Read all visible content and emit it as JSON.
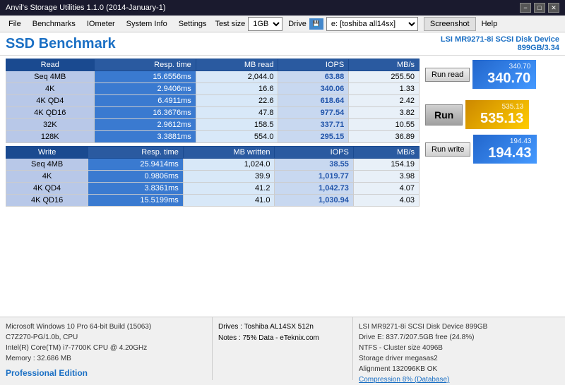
{
  "titleBar": {
    "title": "Anvil's Storage Utilities 1.1.0 (2014-January-1)",
    "minBtn": "−",
    "maxBtn": "□",
    "closeBtn": "✕"
  },
  "menuBar": {
    "file": "File",
    "benchmarks": "Benchmarks",
    "iometer": "IOmeter",
    "systemInfo": "System Info",
    "settings": "Settings",
    "testSizeLabel": "Test size",
    "testSizeValue": "1GB",
    "driveLabel": "Drive",
    "driveValue": "e: [toshiba all14sx]",
    "screenshot": "Screenshot",
    "help": "Help"
  },
  "header": {
    "title": "SSD Benchmark",
    "deviceLine1": "LSI MR9271-8i SCSI Disk Device",
    "deviceLine2": "899GB/3.34"
  },
  "readTable": {
    "headers": [
      "Read",
      "Resp. time",
      "MB read",
      "IOPS",
      "MB/s"
    ],
    "rows": [
      [
        "Seq 4MB",
        "15.6556ms",
        "2,044.0",
        "63.88",
        "255.50"
      ],
      [
        "4K",
        "2.9406ms",
        "16.6",
        "340.06",
        "1.33"
      ],
      [
        "4K QD4",
        "6.4911ms",
        "22.6",
        "618.64",
        "2.42"
      ],
      [
        "4K QD16",
        "16.3676ms",
        "47.8",
        "977.54",
        "3.82"
      ],
      [
        "32K",
        "2.9612ms",
        "158.5",
        "337.71",
        "10.55"
      ],
      [
        "128K",
        "3.3881ms",
        "554.0",
        "295.15",
        "36.89"
      ]
    ]
  },
  "writeTable": {
    "headers": [
      "Write",
      "Resp. time",
      "MB written",
      "IOPS",
      "MB/s"
    ],
    "rows": [
      [
        "Seq 4MB",
        "25.9414ms",
        "1,024.0",
        "38.55",
        "154.19"
      ],
      [
        "4K",
        "0.9806ms",
        "39.9",
        "1,019.77",
        "3.98"
      ],
      [
        "4K QD4",
        "3.8361ms",
        "41.2",
        "1,042.73",
        "4.07"
      ],
      [
        "4K QD16",
        "15.5199ms",
        "41.0",
        "1,030.94",
        "4.03"
      ]
    ]
  },
  "scores": {
    "readLabel": "340.70",
    "readSmall": "340.70",
    "totalLabel": "535.13",
    "totalSmall": "535.13",
    "writeLabel": "194.43",
    "writeSmall": "194.43"
  },
  "buttons": {
    "runRead": "Run read",
    "run": "Run",
    "runWrite": "Run write"
  },
  "footer": {
    "leftLines": [
      "Microsoft Windows 10 Pro 64-bit Build (15063)",
      "C7Z270-PG/1.0b, CPU",
      "Intel(R) Core(TM) i7-7700K CPU @ 4.20GHz",
      "Memory : 32.686 MB"
    ],
    "proEdition": "Professional Edition",
    "centerText": "Drives : Toshiba AL14SX 512n\nNotes : 75% Data - eTeknix.com",
    "rightLines": [
      "LSI MR9271-8i SCSI Disk Device 899GB",
      "Drive E: 837.7/207.5GB free (24.8%)",
      "NTFS - Cluster size 4096B",
      "Storage driver  megasas2",
      "",
      "Alignment 132096KB OK",
      "Compression 8% (Database)"
    ]
  }
}
